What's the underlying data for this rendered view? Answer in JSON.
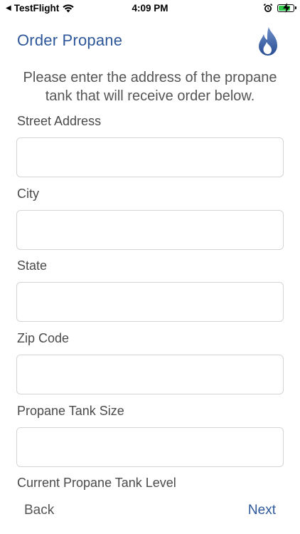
{
  "status_bar": {
    "back_app": "TestFlight",
    "time": "4:09 PM",
    "battery_color": "#30c94a"
  },
  "header": {
    "title": "Order Propane",
    "logo_icon": "propane-flame-icon",
    "accent_color": "#2d579a"
  },
  "instructions": "Please enter the address of the propane tank that will receive order below.",
  "form": {
    "street_label": "Street Address",
    "street_value": "",
    "city_label": "City",
    "city_value": "",
    "state_label": "State",
    "state_value": "",
    "zip_label": "Zip Code",
    "zip_value": "",
    "tank_size_label": "Propane Tank Size",
    "tank_size_value": "",
    "tank_level_label": "Current Propane Tank Level"
  },
  "footer": {
    "back_label": "Back",
    "next_label": "Next"
  }
}
